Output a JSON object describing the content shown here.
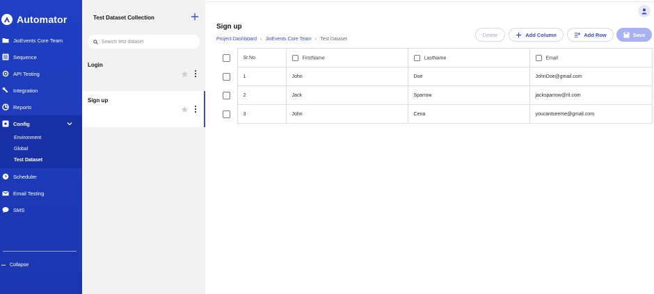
{
  "brand": {
    "name": "Automator"
  },
  "sidebar": {
    "items": [
      {
        "label": "JioEvents Core Team",
        "icon": "folder-icon"
      },
      {
        "label": "Sequence",
        "icon": "sequence-icon"
      },
      {
        "label": "API Testing",
        "icon": "api-icon"
      },
      {
        "label": "Integration",
        "icon": "wrench-icon"
      },
      {
        "label": "Reports",
        "icon": "reports-icon"
      },
      {
        "label": "Config",
        "icon": "config-icon"
      },
      {
        "label": "Scheduler",
        "icon": "clock-icon"
      },
      {
        "label": "Email Testing",
        "icon": "mail-icon"
      },
      {
        "label": "SMS",
        "icon": "chat-icon"
      }
    ],
    "config_sub": [
      "Environment",
      "Global",
      "Test Dataset"
    ],
    "collapse_label": "Collapse"
  },
  "dataset_panel": {
    "title": "Test Dataset Collection",
    "search_placeholder": "Search test dataset",
    "items": [
      {
        "name": "Login"
      },
      {
        "name": "Sign up"
      }
    ]
  },
  "main": {
    "title": "Sign up",
    "breadcrumb": [
      "Project Dashboard",
      "JioEvents Core Team",
      "Test Dataset"
    ],
    "buttons": {
      "delete": "Delete",
      "add_column": "Add Column",
      "add_row": "Add Row",
      "save": "Save"
    },
    "table": {
      "headers": [
        "Sr.No.",
        "FirstName",
        "LastName",
        "Email"
      ],
      "rows": [
        [
          "1",
          "John",
          "Doe",
          "JohnDoe@gmail.com"
        ],
        [
          "2",
          "Jack",
          "Sparrow",
          "jacksparrow@ril.com"
        ],
        [
          "3",
          "John",
          "Cena",
          "youcantseeme@gmail.com"
        ]
      ]
    }
  },
  "colors": {
    "sidebar": "#1f3fc4",
    "accent": "#3949d1",
    "save_disabled": "#a9b2ef",
    "panel_bg": "#f2f2f2"
  }
}
